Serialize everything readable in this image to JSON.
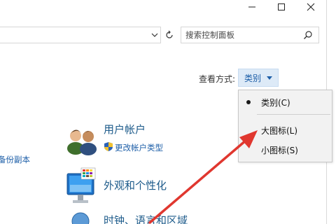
{
  "window": {
    "minimize_label": "Minimize",
    "maximize_label": "Maximize",
    "close_label": "Close"
  },
  "search": {
    "placeholder": "搜索控制面板"
  },
  "view_by": {
    "label": "查看方式:",
    "value": "类别"
  },
  "menu": {
    "items": [
      {
        "label": "类别(C)",
        "selected": true
      },
      {
        "label": "大图标(L)",
        "selected": false
      },
      {
        "label": "小图标(S)",
        "selected": false
      }
    ]
  },
  "left_partial_link": "备份副本",
  "categories": [
    {
      "title": "用户帐户",
      "icon": "users-icon",
      "links": [
        {
          "label": "更改帐户类型",
          "icon": "shield-icon"
        }
      ]
    },
    {
      "title": "外观和个性化",
      "icon": "appearance-icon",
      "links": []
    },
    {
      "title": "时钟、语言和区域",
      "icon": "clock-icon",
      "links": []
    }
  ],
  "colors": {
    "link": "#1e5fa8",
    "category_title": "#1c5a8a",
    "selection_bg": "#ddeaf7",
    "annotation_arrow": "#e0372f"
  }
}
